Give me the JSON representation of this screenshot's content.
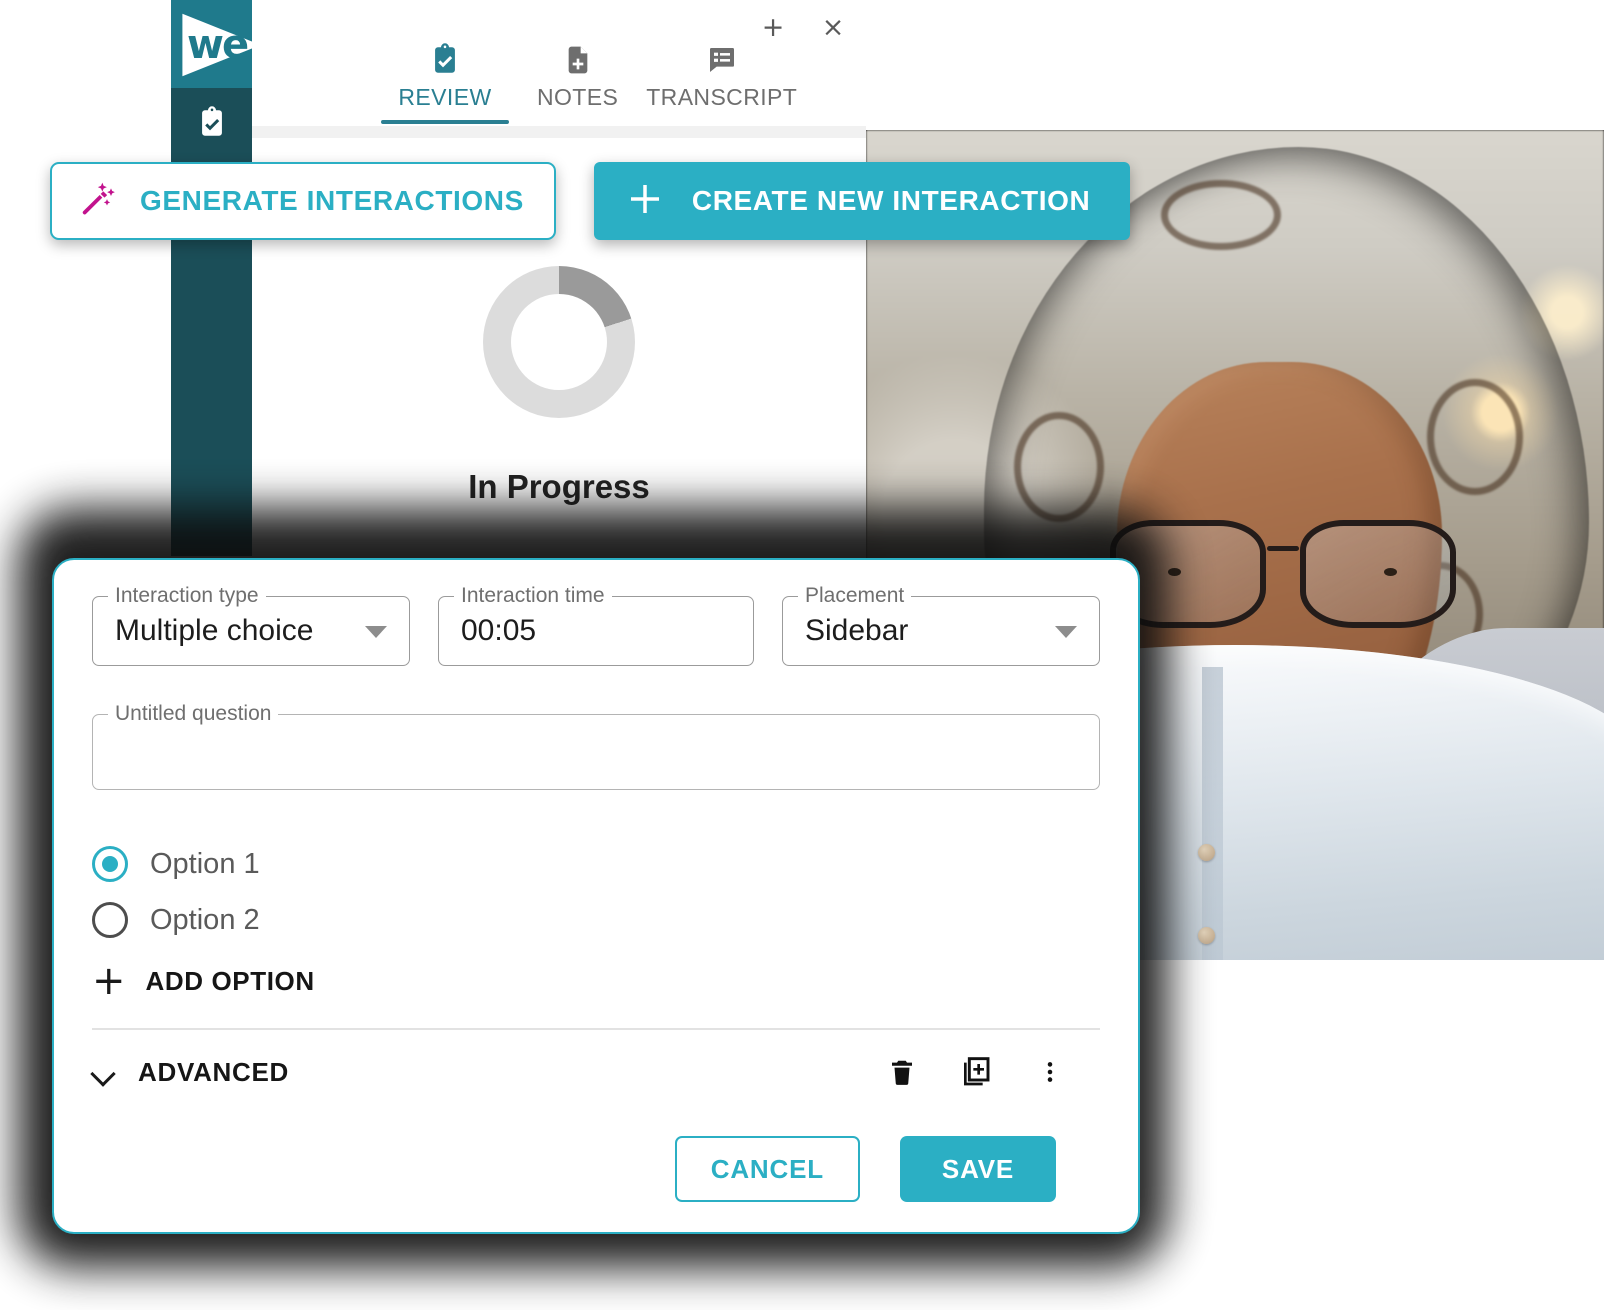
{
  "app": {
    "logo_text": "we",
    "sidebar_icon": "clipboard-check-icon",
    "window_controls": {
      "add_label": "+",
      "close_label": "×"
    },
    "tabs": [
      {
        "label": "REVIEW",
        "icon": "clipboard-check-icon",
        "active": true
      },
      {
        "label": "NOTES",
        "icon": "document-add-icon",
        "active": false
      },
      {
        "label": "TRANSCRIPT",
        "icon": "transcript-list-icon",
        "active": false
      }
    ],
    "status": {
      "label": "In Progress",
      "progress_percent": 20
    }
  },
  "actions": {
    "generate_label": "GENERATE INTERACTIONS",
    "generate_icon": "magic-wand-icon",
    "create_label": "CREATE NEW INTERACTION",
    "create_icon": "plus-icon"
  },
  "dialog": {
    "fields": {
      "interaction_type": {
        "label": "Interaction type",
        "value": "Multiple choice"
      },
      "interaction_time": {
        "label": "Interaction time",
        "value": "00:05"
      },
      "placement": {
        "label": "Placement",
        "value": "Sidebar"
      }
    },
    "question": {
      "label": "Untitled question",
      "value": "",
      "placeholder": ""
    },
    "options": [
      {
        "label": "Option 1",
        "selected": true
      },
      {
        "label": "Option 2",
        "selected": false
      }
    ],
    "add_option_label": "ADD OPTION",
    "advanced_label": "ADVANCED",
    "tool_icons": [
      {
        "name": "delete-icon"
      },
      {
        "name": "duplicate-add-icon"
      },
      {
        "name": "more-vertical-icon"
      }
    ],
    "cancel_label": "CANCEL",
    "save_label": "SAVE"
  },
  "colors": {
    "accent_teal": "#2bafc4",
    "brand_teal": "#1f7a8c",
    "sidebar_dark": "#1b4e58",
    "magic_pink": "#c2128d",
    "progress_track": "#dcdcdc",
    "progress_fill": "#9a9a9a"
  }
}
